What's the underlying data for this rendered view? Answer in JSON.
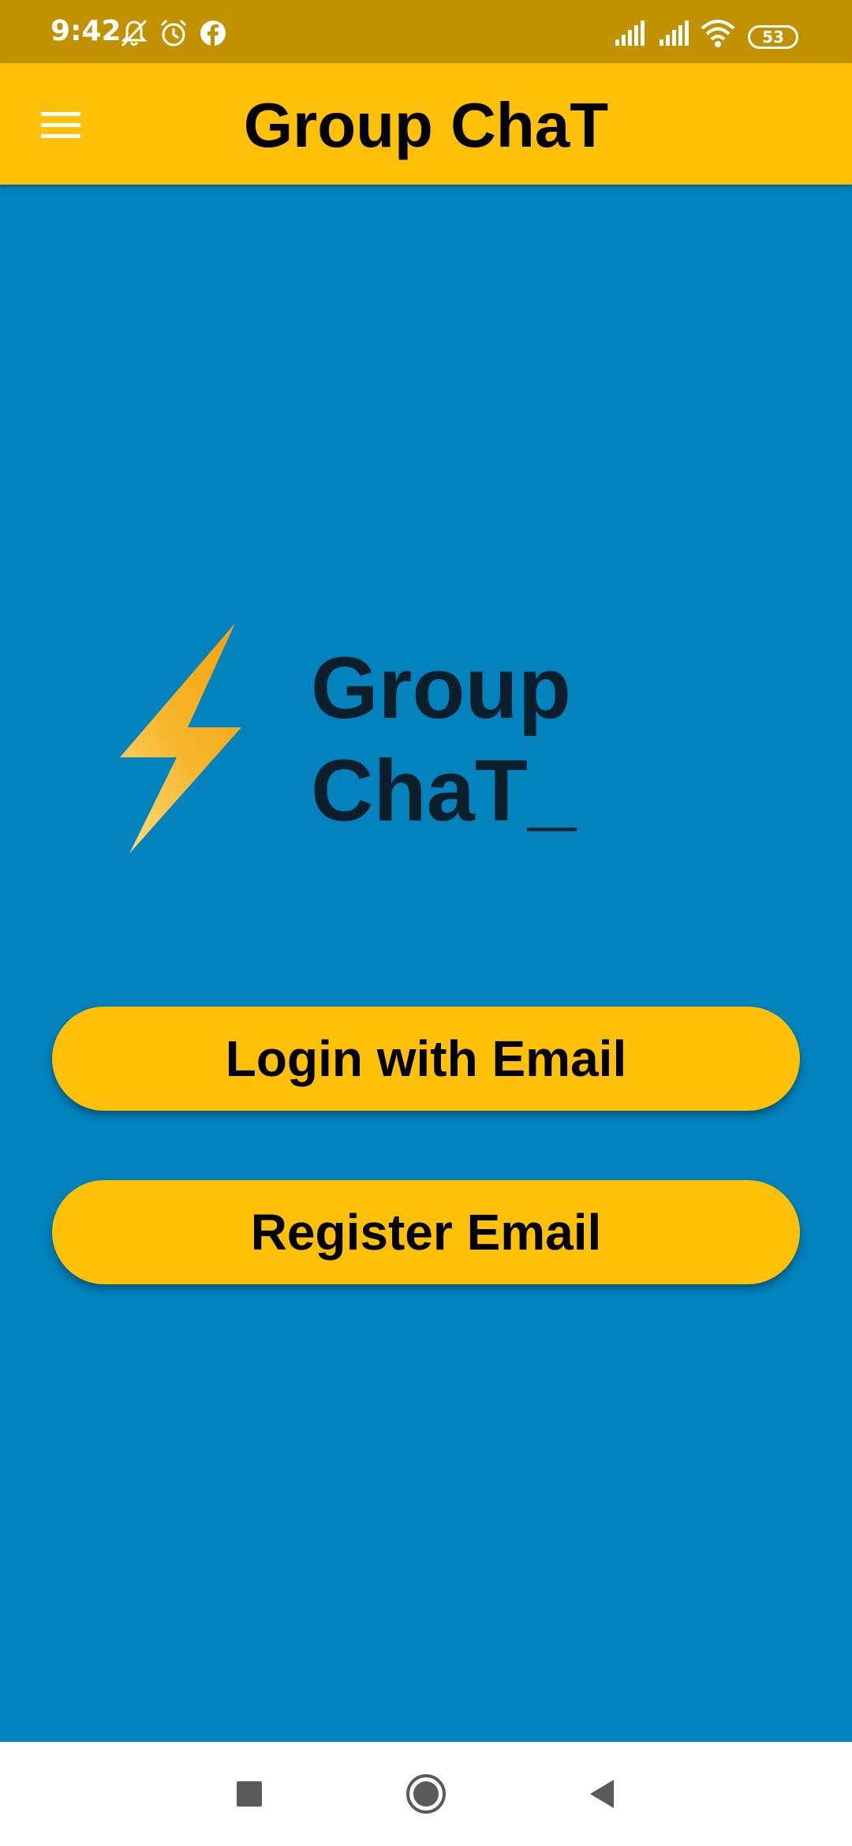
{
  "status_bar": {
    "time": "9:42",
    "battery": "53",
    "icons": [
      "mute-icon",
      "alarm-icon",
      "facebook-icon",
      "signal-icon",
      "signal-icon",
      "wifi-icon",
      "battery-icon"
    ]
  },
  "app_bar": {
    "title": "Group ChaT",
    "menu_icon": "menu-icon"
  },
  "logo": {
    "icon": "lightning-bolt-icon",
    "line1": "Group",
    "line2": "ChaT_"
  },
  "buttons": {
    "login_label": "Login with Email",
    "register_label": "Register Email"
  },
  "nav_bar": {
    "icons": [
      "recent-apps-icon",
      "home-icon",
      "back-icon"
    ]
  },
  "colors": {
    "status_bar": "#C19100",
    "app_bar": "#FFC107",
    "background": "#0283BE",
    "button": "#FFC107",
    "logo_text": "#0B1E2B"
  }
}
